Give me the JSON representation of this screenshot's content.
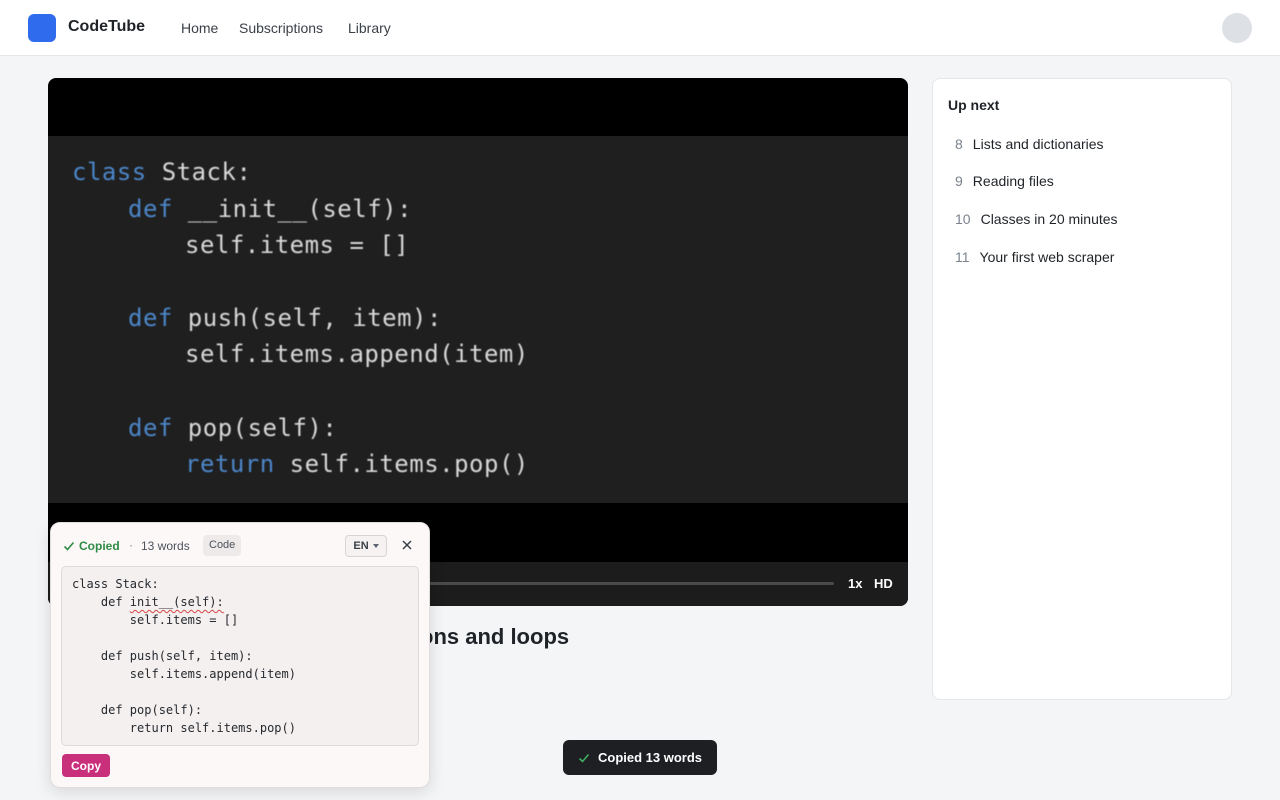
{
  "header": {
    "brand": "CodeTube",
    "nav": [
      "Home",
      "Subscriptions",
      "Library"
    ]
  },
  "player": {
    "code_lines": [
      {
        "kw": "class",
        "rest": " Stack:"
      },
      {
        "kw": "def",
        "rest": " __init__(self):"
      },
      {
        "kw": "",
        "rest": "self.items = []"
      },
      {
        "kw": "def",
        "rest": " push(self, item):"
      },
      {
        "kw": "",
        "rest": "self.items.append(item)"
      },
      {
        "kw": "def",
        "rest": " pop(self):"
      },
      {
        "kw": "return",
        "rest": " self.items.pop()"
      }
    ],
    "speed": "1x",
    "quality": "HD"
  },
  "video": {
    "title_visible": "ons and loops"
  },
  "sidebar": {
    "heading": "Up next",
    "items": [
      {
        "num": "8",
        "label": "Lists and dictionaries"
      },
      {
        "num": "9",
        "label": "Reading files"
      },
      {
        "num": "10",
        "label": "Classes in 20 minutes"
      },
      {
        "num": "11",
        "label": "Your first web scraper"
      }
    ]
  },
  "popover": {
    "status": "Copied",
    "separator": "·",
    "word_count": "13 words",
    "tag": "Code",
    "language": "EN",
    "code_before": "class Stack:\n    def ",
    "code_flagged": "init__(self):",
    "code_after": "\n        self.items = []\n\n    def push(self, item):\n        self.items.append(item)\n\n    def pop(self):\n        return self.items.pop()",
    "copy_label": "Copy"
  },
  "toast": {
    "message": "Copied 13 words"
  },
  "colors": {
    "accent": "#2f6bed",
    "copy_button": "#c9307c",
    "success": "#2e8b45"
  }
}
